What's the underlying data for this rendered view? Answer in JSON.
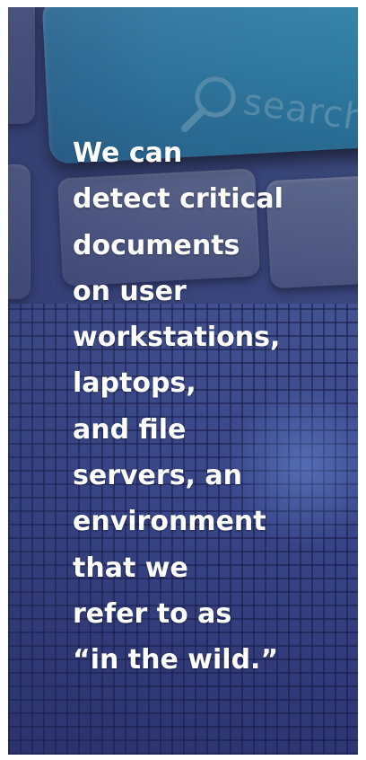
{
  "pull_quote": {
    "text": "We can\ndetect critical\ndocuments\non user\nworkstations,\nlaptops,\nand file\nservers, an\nenvironment\nthat we\nrefer to as\n“in the wild.”"
  },
  "background": {
    "key_label": "search",
    "icon": "magnifier-icon"
  },
  "colors": {
    "panel": "#3a4a78",
    "search_key": "#2f7ea4",
    "text": "#ffffff"
  }
}
